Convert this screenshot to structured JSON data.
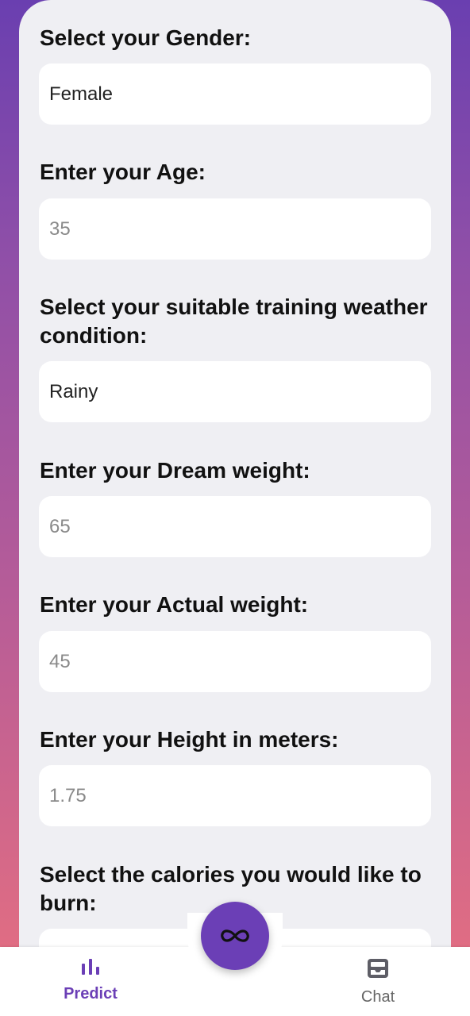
{
  "form": {
    "gender": {
      "label": "Select your Gender:",
      "value": "Female"
    },
    "age": {
      "label": "Enter your Age:",
      "placeholder": "35"
    },
    "weather": {
      "label": "Select your suitable training weather condition:",
      "value": "Rainy"
    },
    "dream_weight": {
      "label": "Enter your Dream weight:",
      "placeholder": "65"
    },
    "actual_weight": {
      "label": "Enter your Actual weight:",
      "placeholder": "45"
    },
    "height": {
      "label": "Enter your Height in meters:",
      "placeholder": "1.75"
    },
    "calories": {
      "label": "Select the calories you would like to burn:"
    }
  },
  "nav": {
    "predict_label": "Predict",
    "chat_label": "Chat",
    "fab_icon": "infinity-icon",
    "predict_icon": "bar-chart-icon",
    "chat_icon": "inbox-icon"
  },
  "colors": {
    "accent": "#6b3fb6",
    "card": "#efeff3"
  }
}
